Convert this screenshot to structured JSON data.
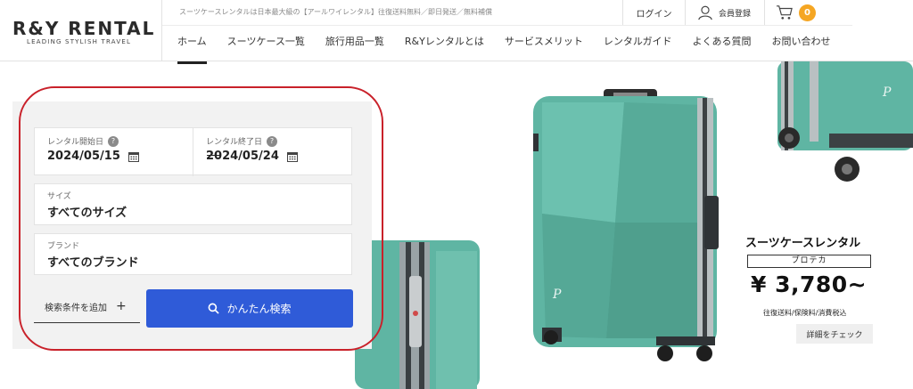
{
  "brand": {
    "name": "R&Y RENTAL",
    "tagline": "LEADING STYLISH TRAVEL"
  },
  "header": {
    "notice": "スーツケースレンタルは日本最大級の【アールワイレンタル】往復送料無料／即日発送／無料補償",
    "login": "ログイン",
    "register": "会員登録",
    "cart_count": "0"
  },
  "nav": {
    "items": [
      "ホーム",
      "スーツケース一覧",
      "旅行用品一覧",
      "R&Yレンタルとは",
      "サービスメリット",
      "レンタルガイド",
      "よくある質問",
      "お問い合わせ"
    ],
    "active_index": 0
  },
  "search": {
    "start_label": "レンタル開始日",
    "start_value": "2024/05/15",
    "end_label": "レンタル終了日",
    "end_value": "2024/05/24",
    "help_mark": "?",
    "size_label": "サイズ",
    "size_value": "すべてのサイズ",
    "brand_label": "ブランド",
    "brand_value": "すべてのブランド",
    "add_condition": "検索条件を追加",
    "add_condition_plus": "+",
    "search_button": "かんたん検索"
  },
  "promo": {
    "title": "スーツケースレンタル",
    "brand_tag": "プロテカ",
    "price": "¥ 3,780~",
    "note": "往復送料/保険料/消費税込",
    "detail_button": "詳細をチェック"
  },
  "colors": {
    "accent_blue": "#2f5bd8",
    "badge_orange": "#f5a623",
    "highlight_red": "#c9212a",
    "suitcase_teal": "#5fb5a3"
  },
  "icons": {
    "user": "user-icon",
    "cart": "cart-icon",
    "calendar": "calendar-icon",
    "search": "search-icon"
  }
}
